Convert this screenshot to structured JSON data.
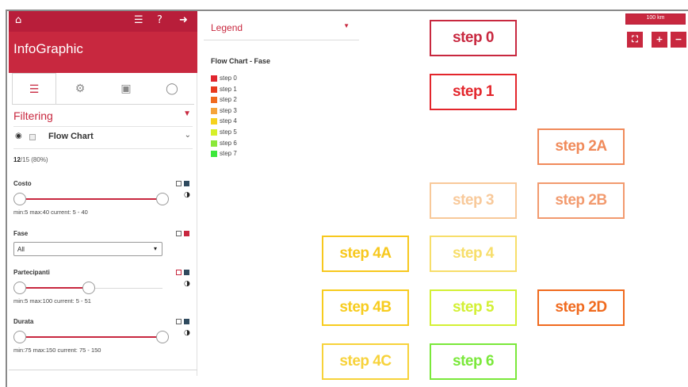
{
  "app": {
    "title": "InfoGraphic"
  },
  "topbar": {
    "icons": [
      "home-icon",
      "list-icon",
      "help-icon",
      "logout-icon"
    ]
  },
  "tabs": [
    {
      "icon": "sliders-icon",
      "glyph": "☰",
      "active": true
    },
    {
      "icon": "gear-icon",
      "glyph": "⚙",
      "active": false
    },
    {
      "icon": "save-icon",
      "glyph": "▣",
      "active": false
    },
    {
      "icon": "comment-icon",
      "glyph": "◯",
      "active": false
    }
  ],
  "filtering": {
    "label": "Filtering"
  },
  "layer": {
    "title": "Flow Chart"
  },
  "count": {
    "shown": "12",
    "total": "/15 (80%)"
  },
  "filters": {
    "costo": {
      "name": "Costo",
      "info": "min:5 max:40 current: 5 - 40",
      "min": 5,
      "max": 40,
      "low": 5,
      "high": 40
    },
    "fase": {
      "name": "Fase",
      "value": "All"
    },
    "partecipanti": {
      "name": "Partecipanti",
      "info": "min:5 max:100 current: 5 - 51",
      "min": 5,
      "max": 100,
      "low": 5,
      "high": 51
    },
    "durata": {
      "name": "Durata",
      "info": "min:75 max:150 current: 75 - 150",
      "min": 75,
      "max": 150,
      "low": 75,
      "high": 150
    }
  },
  "legend": {
    "header": "Legend",
    "subtitle": "Flow Chart - Fase",
    "items": [
      {
        "label": "step 0",
        "color": "#e0262f"
      },
      {
        "label": "step 1",
        "color": "#e83a1e"
      },
      {
        "label": "step 2",
        "color": "#f06a1e"
      },
      {
        "label": "step 3",
        "color": "#f5a43a"
      },
      {
        "label": "step 4",
        "color": "#f5d21e"
      },
      {
        "label": "step 5",
        "color": "#d6f02a"
      },
      {
        "label": "step 6",
        "color": "#8ae83a"
      },
      {
        "label": "step 7",
        "color": "#3ce83a"
      }
    ]
  },
  "scale": {
    "label": "100 km"
  },
  "map_buttons": {
    "extent": "⛶",
    "zoom_in": "+",
    "zoom_out": "−"
  },
  "nodes": {
    "step0": {
      "label": "step 0",
      "color": "#c8283f",
      "fill": "#ffffff"
    },
    "step1": {
      "label": "step 1",
      "color": "#e3262c",
      "fill": "#ffffff"
    },
    "step2a": {
      "label": "step 2A",
      "color": "#f08a5a",
      "fill": "#ffffff"
    },
    "step3": {
      "label": "step 3",
      "color": "#f8c99a",
      "fill": "#ffffff"
    },
    "step2b": {
      "label": "step 2B",
      "color": "#f29a6e",
      "fill": "#ffffff"
    },
    "step4a": {
      "label": "step 4A",
      "color": "#f7c81e",
      "fill": "#ffffff"
    },
    "step4": {
      "label": "step 4",
      "color": "#f7de6a",
      "fill": "#ffffff"
    },
    "step4b": {
      "label": "step 4B",
      "color": "#f7cc1e",
      "fill": "#ffffff"
    },
    "step5": {
      "label": "step 5",
      "color": "#d3f034",
      "fill": "#ffffff"
    },
    "step2d": {
      "label": "step 2D",
      "color": "#f06a1e",
      "fill": "#ffffff"
    },
    "step4c": {
      "label": "step 4C",
      "color": "#f7d23a",
      "fill": "#ffffff"
    },
    "step6": {
      "label": "step 6",
      "color": "#7ae83a",
      "fill": "#ffffff"
    }
  }
}
